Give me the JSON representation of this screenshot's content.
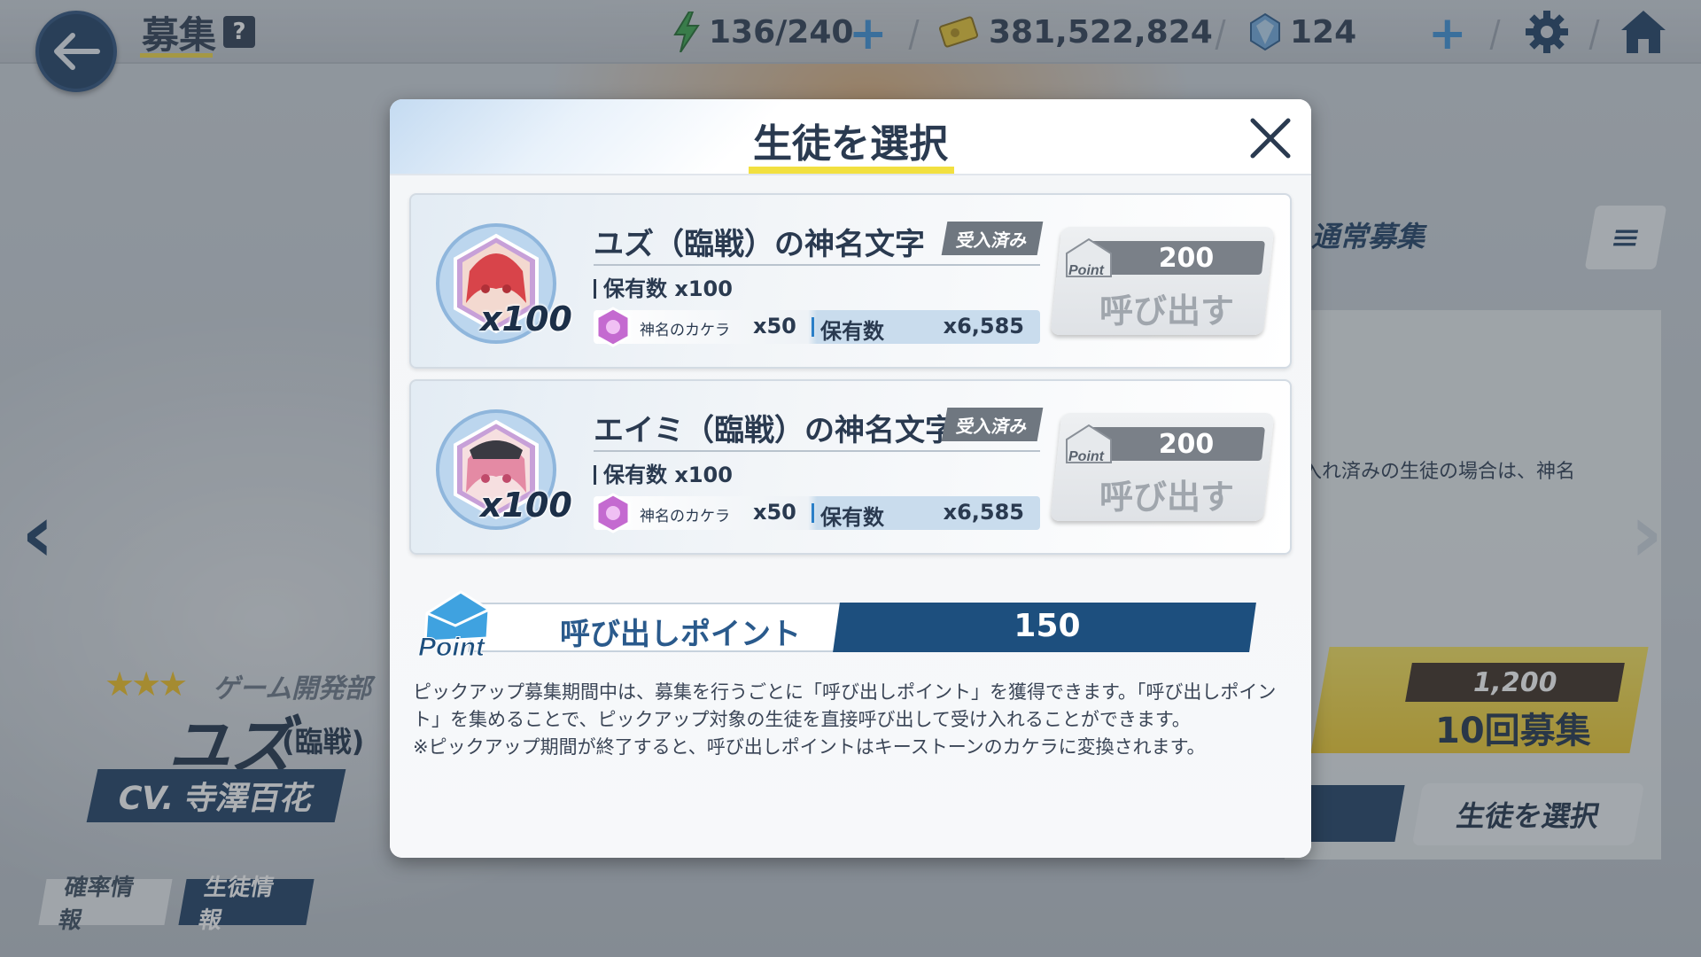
{
  "header": {
    "title": "募集",
    "help_label": "?",
    "ap": "136/240",
    "credits": "381,522,824",
    "pyroxene": "124",
    "plus": "+"
  },
  "background": {
    "stars": "★★★",
    "club": "ゲーム開発部",
    "character_name": "ユズ",
    "character_variant": "(臨戦)",
    "cv": "CV. 寺澤百花",
    "tabs": [
      "確率情報",
      "生徒情報"
    ],
    "banner_label": "通常募集",
    "info_text": "入れ済みの生徒の場合は、神名",
    "recruit_cost": "1,200",
    "recruit_label": "10回募集",
    "select_label": "生徒を選択"
  },
  "modal": {
    "title": "生徒を選択",
    "cards": [
      {
        "name": "ユズ（臨戦）の神名文字",
        "badge": "受入済み",
        "portrait_qty": "x100",
        "owned": "保有数 x100",
        "cost_item": "神名のカケラ",
        "cost_amount": "x50",
        "held_label": "保有数",
        "held_value": "x6,585",
        "point_cost": "200",
        "point_icon_label": "Point",
        "button_label": "呼び出す"
      },
      {
        "name": "エイミ（臨戦）の神名文字",
        "badge": "受入済み",
        "portrait_qty": "x100",
        "owned": "保有数 x100",
        "cost_item": "神名のカケラ",
        "cost_amount": "x50",
        "held_label": "保有数",
        "held_value": "x6,585",
        "point_cost": "200",
        "point_icon_label": "Point",
        "button_label": "呼び出す"
      }
    ],
    "points": {
      "icon_label": "Point",
      "label": "呼び出しポイント",
      "value": "150"
    },
    "description_1": "ピックアップ募集期間中は、募集を行うごとに「呼び出しポイント」を獲得できます。「呼び出しポイント」を集めることで、ピックアップ対象の生徒を直接呼び出して受け入れることができます。",
    "description_2": "※ピックアップ期間が終了すると、呼び出しポイントはキーストーンのカケラに変換されます。"
  },
  "colors": {
    "navy": "#1c3d63",
    "accent_yellow": "#f2e040",
    "point_blue": "#1d4f7e"
  }
}
